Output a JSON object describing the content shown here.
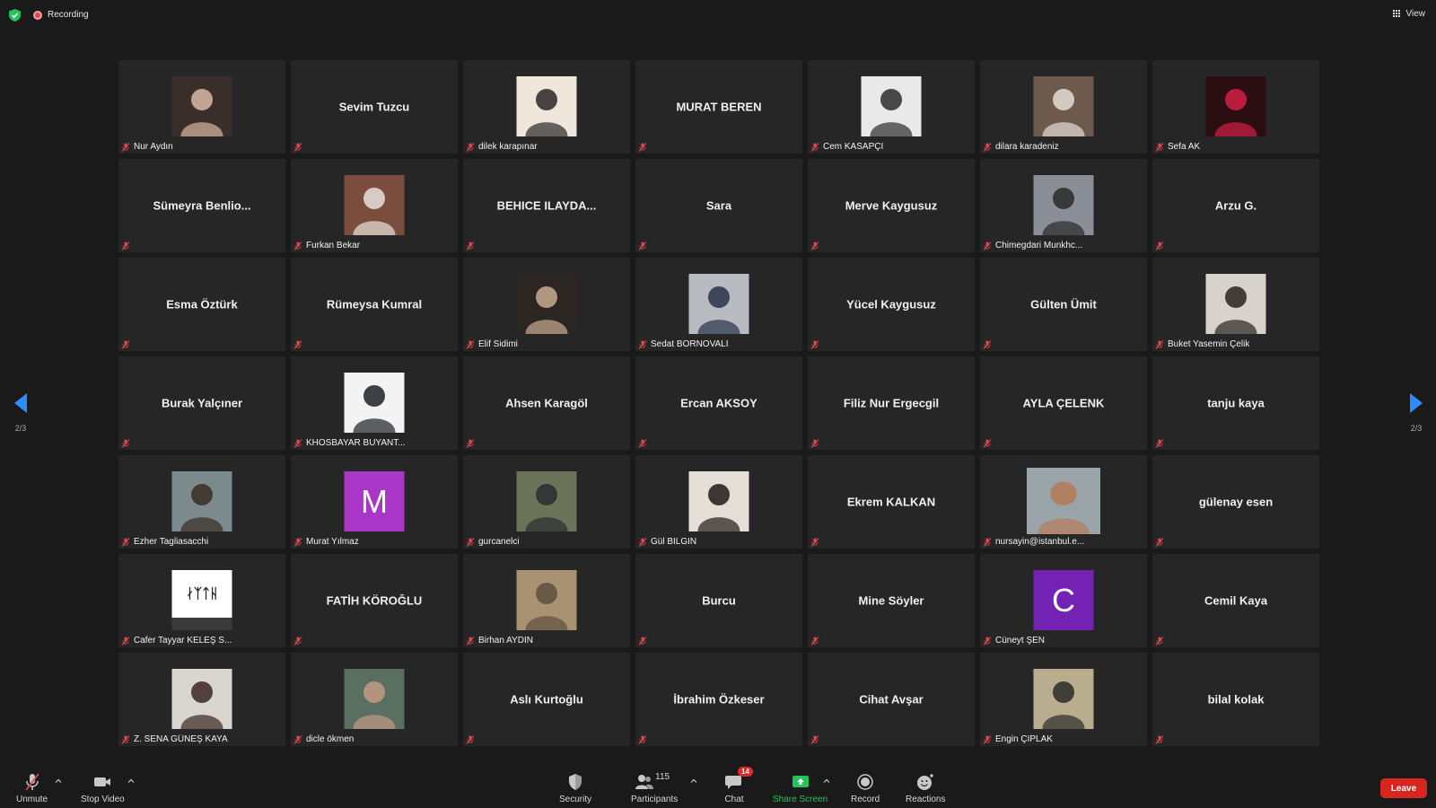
{
  "topbar": {
    "recording_label": "Recording",
    "view_label": "View"
  },
  "pager": {
    "left_page": "2/3",
    "right_page": "2/3"
  },
  "tiles": [
    {
      "name": "Nur Aydın",
      "video": true,
      "bg": "#3a2e2a",
      "fg": "#d9b8a5"
    },
    {
      "name": "Sevim Tuzcu",
      "video": false
    },
    {
      "name": "dilek karapınar",
      "video": true,
      "bg": "#efe7dc",
      "fg": "#2a2626"
    },
    {
      "name": "MURAT BEREN",
      "video": false
    },
    {
      "name": "Cem KASAPÇI",
      "video": true,
      "bg": "#e9e9e9",
      "fg": "#2b2b2b"
    },
    {
      "name": "dilara karadeniz",
      "video": true,
      "bg": "#6d5a4d",
      "fg": "#e6ddd5"
    },
    {
      "name": "Sefa AK",
      "video": true,
      "bg": "#2a0e12",
      "fg": "#d21f46"
    },
    {
      "name": "Sümeyra Benlio...",
      "video": false
    },
    {
      "name": "Furkan Bekar",
      "video": true,
      "bg": "#7a4d3c",
      "fg": "#e8e2dc"
    },
    {
      "name": "BEHICE ILAYDA...",
      "video": false
    },
    {
      "name": "Sara",
      "video": false
    },
    {
      "name": "Merve Kaygusuz",
      "video": false
    },
    {
      "name": "Chimegdari Munkhc...",
      "video": true,
      "bg": "#8a8e96",
      "fg": "#2a2a2a"
    },
    {
      "name": "Arzu G.",
      "video": false
    },
    {
      "name": "Esma Öztürk",
      "video": false
    },
    {
      "name": "Rümeysa Kumral",
      "video": false
    },
    {
      "name": "Elif Sidimi",
      "video": true,
      "bg": "#2b2622",
      "fg": "#c8ad90"
    },
    {
      "name": "Sedat BORNOVALI",
      "video": true,
      "bg": "#b8bcc1",
      "fg": "#273246"
    },
    {
      "name": "Yücel Kaygusuz",
      "video": false
    },
    {
      "name": "Gülten Ümit",
      "video": false
    },
    {
      "name": "Buket Yasemin Çelik",
      "video": true,
      "bg": "#d7d2cb",
      "fg": "#2a2220"
    },
    {
      "name": "Burak Yalçıner",
      "video": false
    },
    {
      "name": "KHOSBAYAR BUYANT...",
      "video": true,
      "bg": "#f3f3f3",
      "fg": "#1e2026"
    },
    {
      "name": "Ahsen Karagöl",
      "video": false
    },
    {
      "name": "Ercan AKSOY",
      "video": false
    },
    {
      "name": "Filiz Nur Ergecgil",
      "video": false
    },
    {
      "name": "AYLA ÇELENK",
      "video": false
    },
    {
      "name": "tanju kaya",
      "video": false
    },
    {
      "name": "Ezher Tagliasacchi",
      "video": true,
      "bg": "#7c8a8e",
      "fg": "#3a2c24"
    },
    {
      "name": "Murat Yılmaz",
      "video": true,
      "letter": "M",
      "bg": "#a936c6"
    },
    {
      "name": "gurcanelci",
      "video": true,
      "bg": "#6b7358",
      "fg": "#2b2d30"
    },
    {
      "name": "Gül BİLGİN",
      "video": true,
      "bg": "#e4dfd6",
      "fg": "#201a18"
    },
    {
      "name": "Ekrem  KALKAN",
      "video": false
    },
    {
      "name": "nursayin@istanbul.e...",
      "video": true,
      "wide": true,
      "bg": "#9aa3a8",
      "fg": "#b57a57"
    },
    {
      "name": "gülenay esen",
      "video": false
    },
    {
      "name": "Cafer Tayyar KELEŞ S...",
      "video": true,
      "logo": "ᛅᛉᛏᚺ",
      "bg": "#ffffff",
      "fg": "#222222"
    },
    {
      "name": "FATİH KÖROĞLU",
      "video": false
    },
    {
      "name": "Birhan AYDIN",
      "video": true,
      "bg": "#a89272",
      "fg": "#5e5040"
    },
    {
      "name": "Burcu",
      "video": false
    },
    {
      "name": "Mine Söyler",
      "video": false
    },
    {
      "name": "Cüneyt ŞEN",
      "video": true,
      "letter": "C",
      "bg": "#7322b3"
    },
    {
      "name": "Cemil Kaya",
      "video": false
    },
    {
      "name": "Z. SENA GÜNEŞ KAYA",
      "video": true,
      "bg": "#d9d5d0",
      "fg": "#3a2620"
    },
    {
      "name": "dicle ökmen",
      "video": true,
      "bg": "#5a6e62",
      "fg": "#c29a82"
    },
    {
      "name": "Aslı Kurtoğlu",
      "video": false
    },
    {
      "name": "İbrahim Özkeser",
      "video": false
    },
    {
      "name": "Cihat Avşar",
      "video": false
    },
    {
      "name": "Engin ÇIPLAK",
      "video": true,
      "bg": "#b8ad8f",
      "fg": "#2b2a28"
    },
    {
      "name": "bilal kolak",
      "video": false
    }
  ],
  "toolbar": {
    "unmute": "Unmute",
    "stop_video": "Stop Video",
    "security": "Security",
    "participants": "Participants",
    "participants_count": "115",
    "chat": "Chat",
    "chat_badge": "14",
    "share_screen": "Share Screen",
    "record": "Record",
    "reactions": "Reactions",
    "leave": "Leave"
  },
  "colors": {
    "background": "#1a1a1a",
    "tile": "#262626",
    "accent_blue": "#2d8cff",
    "share_green": "#23c25a",
    "leave_red": "#d7261f",
    "muted_red": "#e0464b"
  }
}
